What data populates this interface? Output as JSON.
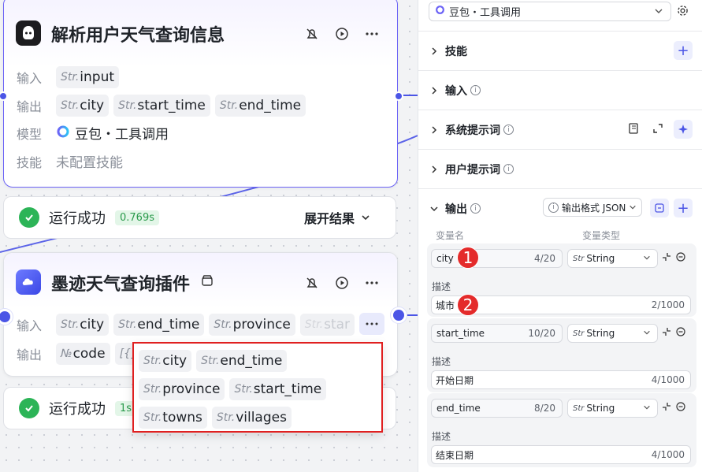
{
  "node1": {
    "title": "解析用户天气查询信息",
    "input_label": "输入",
    "output_label": "输出",
    "model_label": "模型",
    "skill_label": "技能",
    "inputs": [
      {
        "type": "Str.",
        "name": "input"
      }
    ],
    "outputs": [
      {
        "type": "Str.",
        "name": "city"
      },
      {
        "type": "Str.",
        "name": "start_time"
      },
      {
        "type": "Str.",
        "name": "end_time"
      }
    ],
    "model": "豆包・工具调用",
    "skill": "未配置技能",
    "icon": "ghost-icon"
  },
  "status1": {
    "text": "运行成功",
    "time": "0.769s",
    "expand": "展开结果"
  },
  "node2": {
    "title": "墨迹天气查询插件",
    "input_label": "输入",
    "output_label": "输出",
    "inputs": [
      {
        "type": "Str.",
        "name": "city"
      },
      {
        "type": "Str.",
        "name": "end_time"
      },
      {
        "type": "Str.",
        "name": "province"
      },
      {
        "type": "Str.",
        "name": "star"
      }
    ],
    "outputs": [
      {
        "type": "№",
        "name": "code"
      },
      {
        "type": "[{}]",
        "name": ""
      }
    ],
    "icon": "cloud-icon"
  },
  "status2": {
    "text": "运行成功",
    "time": "1s"
  },
  "popup": {
    "items": [
      {
        "type": "Str.",
        "name": "city"
      },
      {
        "type": "Str.",
        "name": "end_time"
      },
      {
        "type": "Str.",
        "name": "province"
      },
      {
        "type": "Str.",
        "name": "start_time"
      },
      {
        "type": "Str.",
        "name": "towns"
      },
      {
        "type": "Str.",
        "name": "villages"
      }
    ]
  },
  "panel": {
    "model": "豆包・工具调用",
    "sections": {
      "skill": "技能",
      "input": "输入",
      "system_prompt": "系统提示词",
      "user_prompt": "用户提示词",
      "output": "输出"
    },
    "output_format": "输出格式 JSON",
    "col_name": "变量名",
    "col_type": "变量类型",
    "desc_label": "描述",
    "variables": [
      {
        "name": "city",
        "count": "4/20",
        "type_pre": "Str",
        "type": "String",
        "desc": "城市",
        "desc_count": "2/1000"
      },
      {
        "name": "start_time",
        "count": "10/20",
        "type_pre": "Str",
        "type": "String",
        "desc": "开始日期",
        "desc_count": "4/1000"
      },
      {
        "name": "end_time",
        "count": "8/20",
        "type_pre": "Str",
        "type": "String",
        "desc": "结束日期",
        "desc_count": "4/1000"
      }
    ]
  },
  "markers": [
    "1",
    "2"
  ],
  "colors": {
    "accent": "#4b55e6",
    "success": "#2cb457",
    "highlight": "#e02020"
  }
}
